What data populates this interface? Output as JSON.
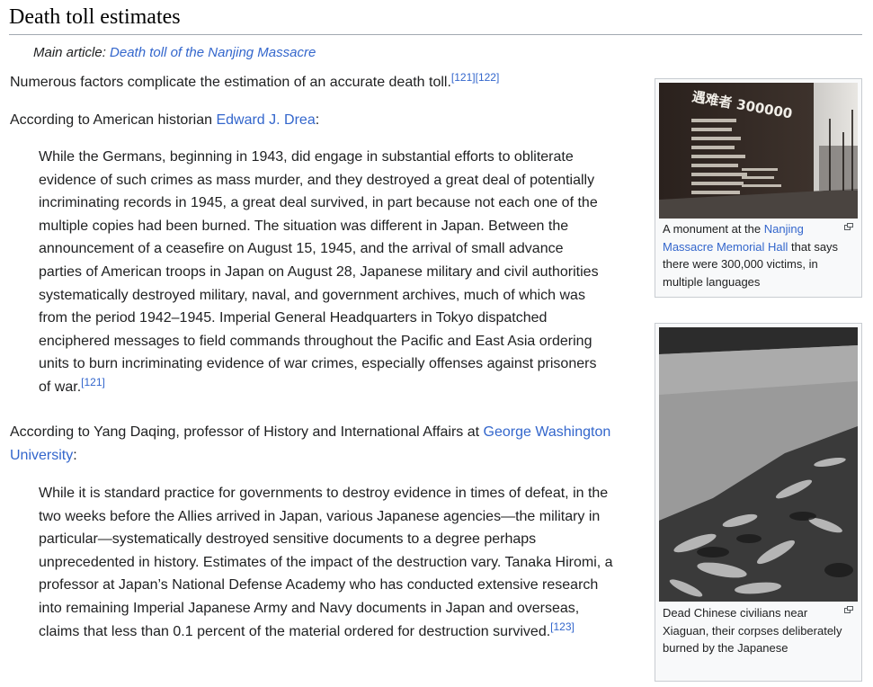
{
  "section": {
    "title": "Death toll estimates",
    "hatnote_prefix": "Main article: ",
    "hatnote_link": "Death toll of the Nanjing Massacre"
  },
  "intro": {
    "text": "Numerous factors complicate the estimation of an accurate death toll.",
    "ref1": "[121]",
    "ref2": "[122]"
  },
  "drea": {
    "prefix": "According to American historian ",
    "link": "Edward J. Drea",
    "suffix": ":"
  },
  "quote1": {
    "text": "While the Germans, beginning in 1943, did engage in substantial efforts to obliterate evidence of such crimes as mass murder, and they destroyed a great deal of potentially incriminating records in 1945, a great deal survived, in part because not each one of the multiple copies had been burned. The situation was different in Japan. Between the announcement of a ceasefire on August 15, 1945, and the arrival of small advance parties of American troops in Japan on August 28, Japanese military and civil authorities systematically destroyed military, naval, and government archives, much of which was from the period 1942–1945. Imperial General Headquarters in Tokyo dispatched enciphered messages to field commands throughout the Pacific and East Asia ordering units to burn incriminating evidence of war crimes, especially offenses against prisoners of war.",
    "ref": "[121]"
  },
  "yang": {
    "prefix": "According to Yang Daqing, professor of History and International Affairs at ",
    "link": "George Washington University",
    "suffix": ":"
  },
  "quote2": {
    "text": "While it is standard practice for governments to destroy evidence in times of defeat, in the two weeks before the Allies arrived in Japan, various Japanese agencies—the military in particular—systematically destroyed sensitive documents to a degree perhaps unprecedented in history. Estimates of the impact of the destruction vary. Tanaka Hiromi, a professor at Japan’s National Defense Academy who has conducted extensive research into remaining Imperial Japanese Army and Navy documents in Japan and overseas, claims that less than 0.1 percent of the material ordered for destruction survived.",
    "ref": "[123]"
  },
  "thumb1": {
    "image_text": "遇难者 300000",
    "caption_prefix": "A monument at the ",
    "caption_link": "Nanjing Massacre Memorial Hall",
    "caption_suffix": " that says there were 300,000 victims, in multiple languages"
  },
  "thumb2": {
    "caption": "Dead Chinese civilians near Xiaguan, their corpses deliberately burned by the Japanese"
  },
  "colors": {
    "link": "#3366cc",
    "text": "#202122",
    "border": "#c8ccd1",
    "thumb_bg": "#f8f9fa"
  },
  "icons": {
    "enlarge": "magnify-clip-icon"
  }
}
